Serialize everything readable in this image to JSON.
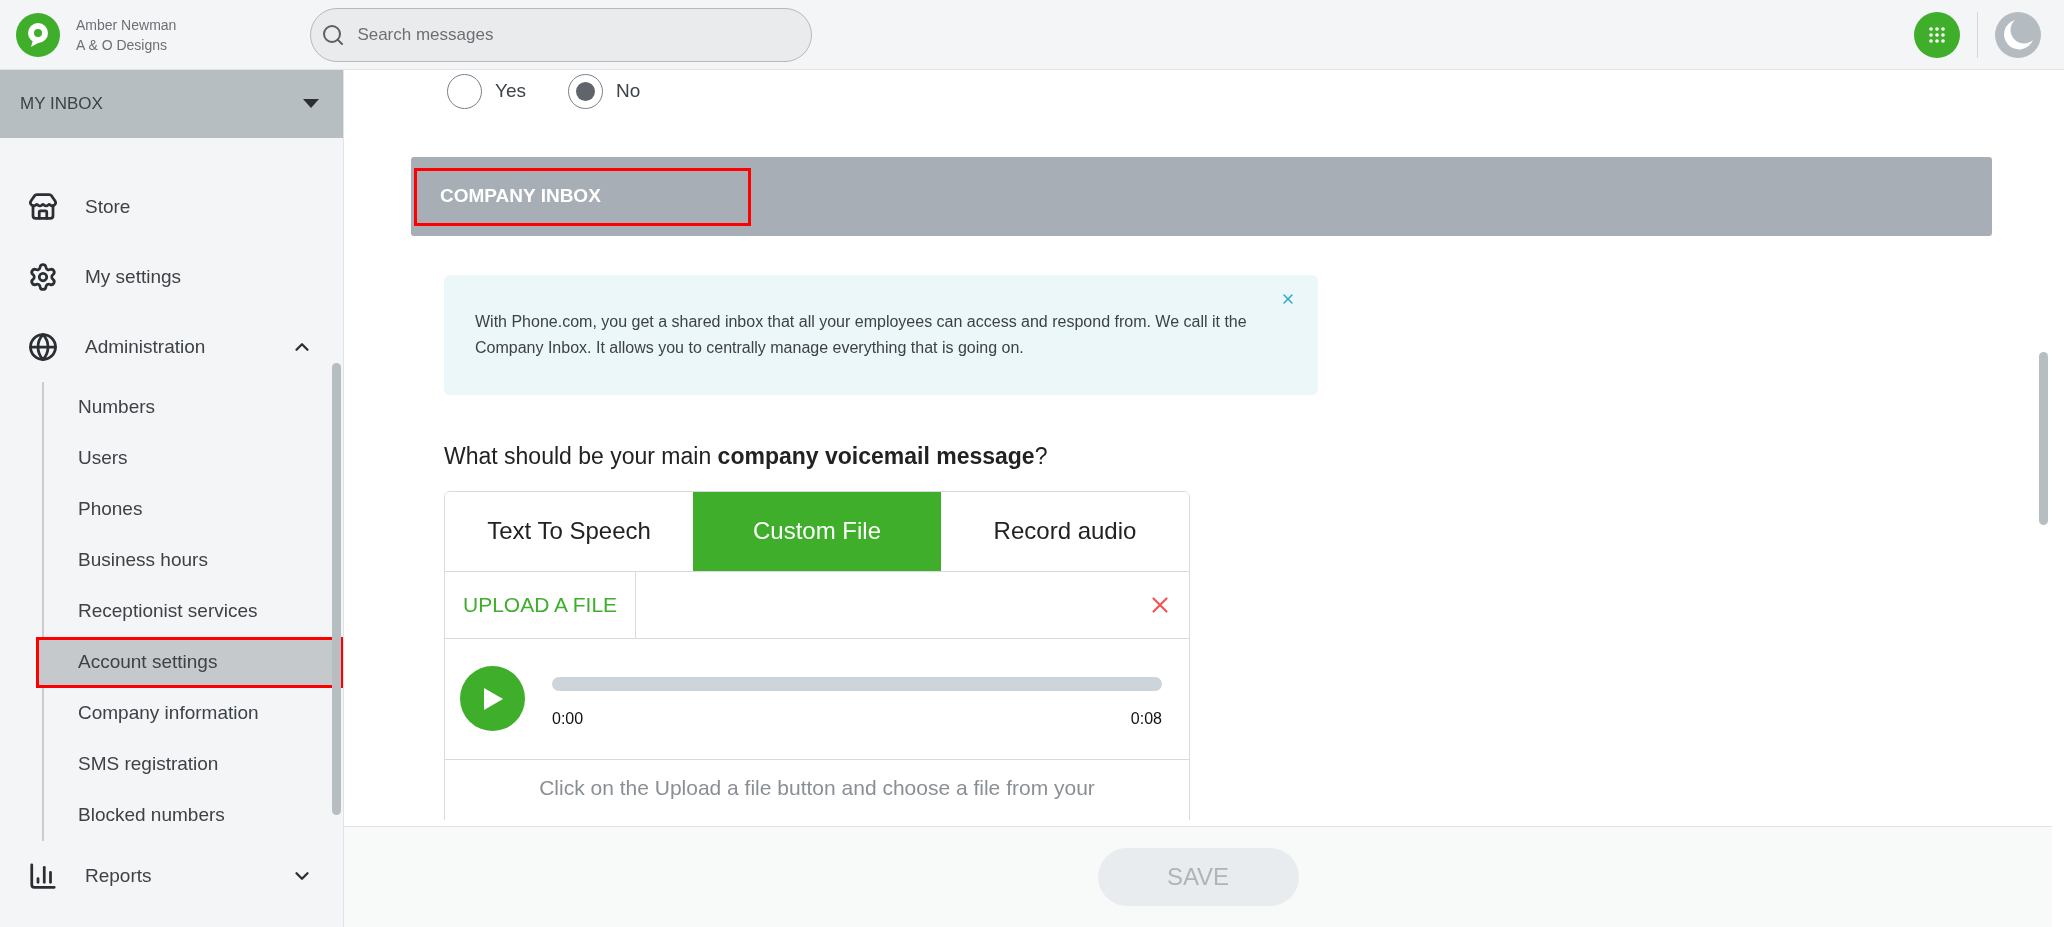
{
  "user": {
    "name": "Amber Newman",
    "company": "A & O Designs"
  },
  "search": {
    "placeholder": "Search messages"
  },
  "sidebar": {
    "header": "MY INBOX",
    "items": [
      {
        "label": "Store"
      },
      {
        "label": "My settings"
      },
      {
        "label": "Administration",
        "expanded": true,
        "children": [
          {
            "label": "Numbers",
            "highlighted": false
          },
          {
            "label": "Users",
            "highlighted": false
          },
          {
            "label": "Phones",
            "highlighted": false
          },
          {
            "label": "Business hours",
            "highlighted": false
          },
          {
            "label": "Receptionist services",
            "highlighted": false
          },
          {
            "label": "Account settings",
            "highlighted": true
          },
          {
            "label": "Company information",
            "highlighted": false
          },
          {
            "label": "SMS registration",
            "highlighted": false
          },
          {
            "label": "Blocked numbers",
            "highlighted": false
          }
        ]
      },
      {
        "label": "Reports",
        "expanded": false
      }
    ]
  },
  "radios": [
    {
      "label": "Yes",
      "selected": false
    },
    {
      "label": "No",
      "selected": true
    }
  ],
  "section": {
    "title": "COMPANY INBOX",
    "highlighted": true
  },
  "info": {
    "text": "With Phone.com, you get a shared inbox that all your employees can access and respond from. We call it the Company Inbox. It allows you to centrally manage everything that is going on."
  },
  "question": "What should be your main **company voicemail message**?",
  "tabs": [
    {
      "label": "Text To Speech",
      "selected": false
    },
    {
      "label": "Custom File",
      "selected": true
    },
    {
      "label": "Record audio",
      "selected": false
    }
  ],
  "upload": {
    "label": "UPLOAD A FILE"
  },
  "player": {
    "start": "0:00",
    "end": "0:08"
  },
  "hint": "Click on the Upload a file button and choose a file from your",
  "save": {
    "label": "SAVE",
    "disabled": true
  }
}
